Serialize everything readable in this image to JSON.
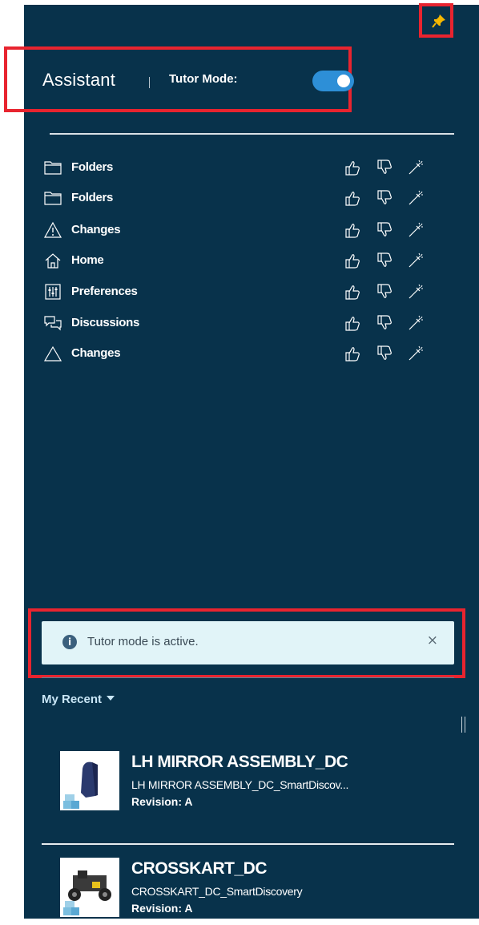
{
  "panel": {
    "title": "Assistant",
    "tutor_mode_label": "Tutor Mode:",
    "tutor_mode_on": true
  },
  "suggestions": [
    {
      "label": "Folders",
      "icon": "folder-icon"
    },
    {
      "label": "Folders",
      "icon": "folder-icon"
    },
    {
      "label": "Changes",
      "icon": "warning-icon"
    },
    {
      "label": "Home",
      "icon": "home-icon"
    },
    {
      "label": "Preferences",
      "icon": "preferences-icon"
    },
    {
      "label": "Discussions",
      "icon": "discussions-icon"
    },
    {
      "label": "Changes",
      "icon": "triangle-icon"
    }
  ],
  "notice": {
    "message": "Tutor mode is active.",
    "close": "×",
    "info": "i"
  },
  "recent": {
    "label": "My Recent",
    "items": [
      {
        "name": "LH MIRROR ASSEMBLY_DC",
        "subtitle": "LH MIRROR ASSEMBLY_DC_SmartDiscov...",
        "revision": "Revision:  A"
      },
      {
        "name": "CROSSKART_DC",
        "subtitle": "CROSSKART_DC_SmartDiscovery",
        "revision": "Revision:  A"
      }
    ]
  },
  "colors": {
    "panel_bg": "#08324b",
    "highlight": "#e8242f",
    "toggle": "#2d8fd7",
    "notice_bg": "#e1f4f8"
  }
}
